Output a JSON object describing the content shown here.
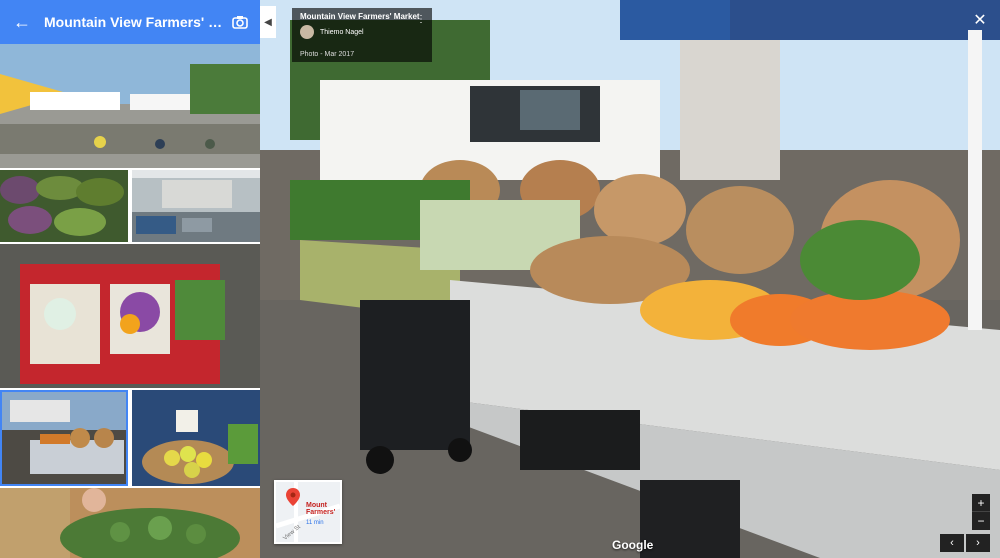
{
  "panel": {
    "title": "Mountain View Farmers' Market",
    "back_icon": "back-arrow-icon",
    "camera_icon": "camera-icon"
  },
  "thumbnails": [
    {
      "name": "thumb-market-overview",
      "desc_icon": "photo"
    },
    {
      "name": "thumb-avocados"
    },
    {
      "name": "thumb-market-stalls"
    },
    {
      "name": "thumb-produce-bags"
    },
    {
      "name": "thumb-vegetable-stand"
    },
    {
      "name": "thumb-lemons-basket"
    },
    {
      "name": "thumb-broccoli"
    }
  ],
  "viewer": {
    "info": {
      "title": "Mountain View Farmers' Market",
      "author": "Thiemo Nagel",
      "date": "Photo - Mar 2017"
    },
    "minimap": {
      "place_label": "Mount\nFarmers'",
      "eta": "11 min",
      "street": "View St"
    },
    "google_label": "Google",
    "close_icon": "close-icon",
    "zoom_in": "+",
    "zoom_out": "−",
    "prev": "‹",
    "next": "›"
  },
  "colors": {
    "header_blue": "#4285f4",
    "card_bg": "#000000"
  }
}
